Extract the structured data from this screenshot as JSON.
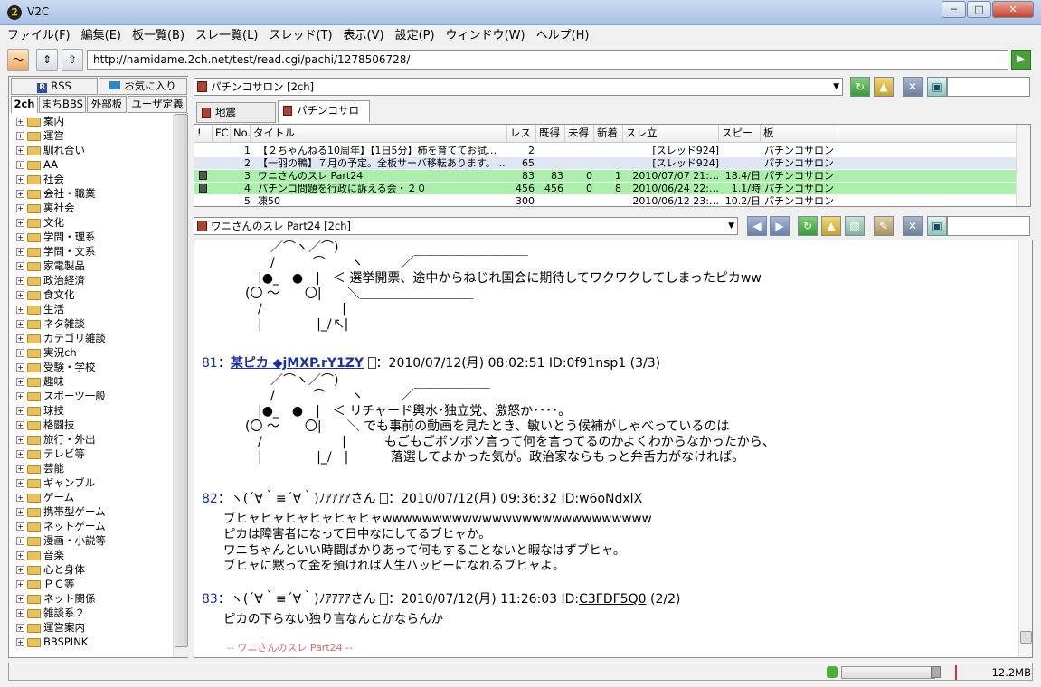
{
  "window": {
    "title": "V2C",
    "minimize": "─",
    "maximize": "□",
    "close": "✕"
  },
  "menu": [
    "ファイル(F)",
    "編集(E)",
    "板一覧(B)",
    "スレ一覧(L)",
    "スレッド(T)",
    "表示(V)",
    "設定(P)",
    "ウィンドウ(W)",
    "ヘルプ(H)"
  ],
  "address": {
    "url": "http://namidame.2ch.net/test/read.cgi/pachi/1278506728/"
  },
  "left": {
    "tabs_row1": [
      "RSS",
      "お気に入り"
    ],
    "tabs_row2": [
      "2ch",
      "まちBBS",
      "外部板",
      "ユーザ定義"
    ],
    "tree": [
      "案内",
      "運営",
      "馴れ合い",
      "AA",
      "社会",
      "会社・職業",
      "裏社会",
      "文化",
      "学問・理系",
      "学問・文系",
      "家電製品",
      "政治経済",
      "食文化",
      "生活",
      "ネタ雑談",
      "カテゴリ雑談",
      "実況ch",
      "受験・学校",
      "趣味",
      "スポーツ一般",
      "球技",
      "格闘技",
      "旅行・外出",
      "テレビ等",
      "芸能",
      "ギャンブル",
      "ゲーム",
      "携帯型ゲーム",
      "ネットゲーム",
      "漫画・小説等",
      "音楽",
      "心と身体",
      "ＰＣ等",
      "ネット関係",
      "雑談系２",
      "運営案内",
      "BBSPINK"
    ]
  },
  "board": {
    "combo": "パチンコサロン [2ch]",
    "tabs": [
      "地震headline",
      "パチンコサロン"
    ]
  },
  "list": {
    "headers": [
      "!",
      "FC",
      "No.",
      "タイトル",
      "レス",
      "既得",
      "未得",
      "新着",
      "スレ立",
      "スピード",
      "板"
    ],
    "rows": [
      {
        "no": "1",
        "title": "【２ちゃんねる10周年】【1日5分】柿を育ててお試…",
        "res": "2",
        "got": "",
        "unread": "",
        "new": "",
        "date": "[スレッド924]",
        "speed": "",
        "board": "パチンコサロン",
        "green": false
      },
      {
        "no": "2",
        "title": "【一羽の鴨】７月の予定。全板サーバ移転あります。…",
        "res": "65",
        "got": "",
        "unread": "",
        "new": "",
        "date": "[スレッド924]",
        "speed": "",
        "board": "パチンコサロン",
        "green": false
      },
      {
        "no": "3",
        "title": "ワニさんのスレ Part24",
        "res": "83",
        "got": "83",
        "unread": "0",
        "new": "1",
        "date": "2010/07/07 21:…",
        "speed": "18.4/日",
        "board": "パチンコサロン",
        "green": true
      },
      {
        "no": "4",
        "title": "パチンコ問題を行政に訴える会・２０",
        "res": "456",
        "got": "456",
        "unread": "0",
        "new": "8",
        "date": "2010/06/24 22:…",
        "speed": "1.1/時",
        "board": "パチンコサロン",
        "green": true
      },
      {
        "no": "5",
        "title": "凍50",
        "res": "300",
        "got": "",
        "unread": "",
        "new": "",
        "date": "2010/06/12 23:…",
        "speed": "10.2/日",
        "board": "パチンコサロン",
        "green": false
      }
    ]
  },
  "thread": {
    "combo": "ワニさんのスレ Part24 [2ch]",
    "aa1": "　　　　　／⌒ヽ／⌒)\n　　　　　/　　　⌒　　ヽ　　　／￣￣￣￣￣￣￣￣￣\n　　　　|●_　●　|　＜ 選挙開票、途中からねじれ国会に期待してワクワクしてしまったピカww\n　　　(〇 ～　　〇|　　＼＿＿＿＿＿＿＿＿＿\n　　　　/　　　　　　 |\n　　　　|　　　　 |_/　|",
    "res81": {
      "num": "81",
      "name": "某ピカ ◆jMXP.rY1ZY",
      "date": "：2010/07/12(月) 08:02:51 ID:0f91nsp1",
      "count": "(3/3)"
    },
    "aa2": "　　　　　／⌒ヽ／⌒)\n　　　　　/　　　⌒　　ヽ　　　／￣￣￣￣￣￣\n　　　　|●_　●　|　＜ リチャード輿水･独立党、激怒か････。\n　　　(〇 ～　　〇|　　＼ でも事前の動画を見たとき、敏いとう候補がしゃべっているのは\n　　　　/　　　　　　 |　　　もごもごボソボソ言って何を言ってるのかよくわからなかったから、\n　　　　|　　　　 |_/　|　　　 落選してよかった気が。政治家ならもっと弁舌力がなければ。",
    "res82": {
      "num": "82",
      "name": "：ヽ(´∀｀≡´∀｀)ﾉｱｱｱｱさん",
      "date": "：2010/07/12(月) 09:36:32 ID:w6oNdxlX"
    },
    "body82": "ブヒャヒャヒャヒャヒャヒャwwwwwwwwwwwwwwwwwwwwwwwwwww\nピカは障害者になって日中なにしてるブヒャか。\nワニちゃんといい時間ばかりあって何もすることないと暇なはずブヒャ。\nブヒャに黙って金を預ければ人生ハッピーになれるブヒャよ。",
    "res83": {
      "num": "83",
      "name": "：ヽ(´∀｀≡´∀｀)ﾉｱｱｱｱさん",
      "date": "：2010/07/12(月) 11:26:03 ID:",
      "id_link": "C3FDF5Q0",
      "count": "(2/2)"
    },
    "body83": "ピカの下らない独り言なんとかならんか",
    "footer": "-- ワニさんのスレ Part24 --"
  },
  "status": {
    "memory": "12.2MB"
  }
}
